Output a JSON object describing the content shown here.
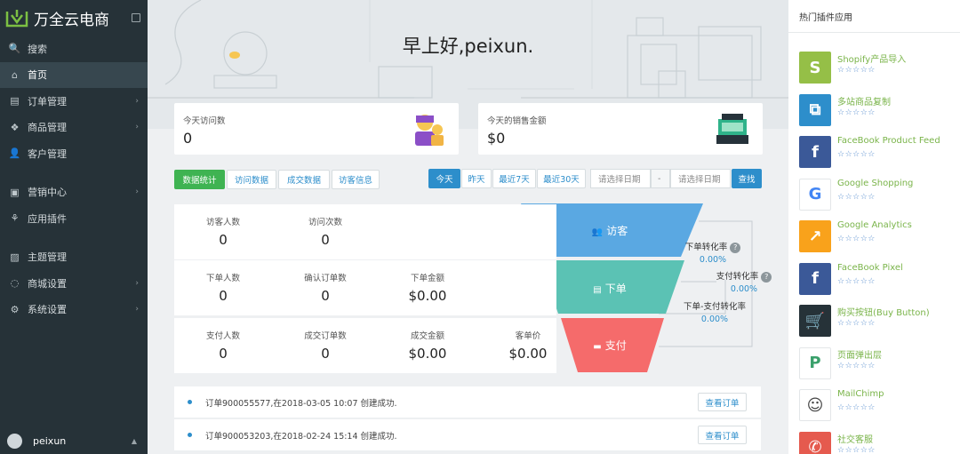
{
  "brand": {
    "name": "万全云电商"
  },
  "nav": [
    {
      "label": "搜索",
      "icon": "search-icon",
      "glyph": "🔍"
    },
    {
      "label": "首页",
      "icon": "home-icon",
      "glyph": "⌂",
      "active": true
    },
    {
      "label": "订单管理",
      "icon": "order-icon",
      "glyph": "▤",
      "arrow": true
    },
    {
      "label": "商品管理",
      "icon": "goods-icon",
      "glyph": "❖",
      "arrow": true
    },
    {
      "label": "客户管理",
      "icon": "customer-icon",
      "glyph": "👤"
    },
    {
      "label": "营销中心",
      "icon": "marketing-icon",
      "glyph": "▣",
      "arrow": true,
      "gap": true
    },
    {
      "label": "应用插件",
      "icon": "plugin-icon",
      "glyph": "⚘"
    },
    {
      "label": "主题管理",
      "icon": "theme-icon",
      "glyph": "▨",
      "gap": true
    },
    {
      "label": "商城设置",
      "icon": "mall-settings-icon",
      "glyph": "◌",
      "arrow": true
    },
    {
      "label": "系统设置",
      "icon": "system-settings-icon",
      "glyph": "⚙",
      "arrow": true
    }
  ],
  "user": {
    "name": "peixun"
  },
  "greeting": "早上好,peixun.",
  "stats": {
    "visits": {
      "label": "今天访问数",
      "value": "0"
    },
    "sales": {
      "label": "今天的销售金额",
      "value": "$0"
    }
  },
  "tabs": [
    "数据统计",
    "访问数据",
    "成交数据",
    "访客信息"
  ],
  "ranges": [
    "今天",
    "昨天",
    "最近7天",
    "最近30天"
  ],
  "date_range": {
    "start_placeholder": "请选择日期",
    "separator": "-",
    "end_placeholder": "请选择日期",
    "search_label": "查找"
  },
  "funnel": {
    "rows": [
      {
        "cells": [
          {
            "label": "访客人数",
            "value": "0"
          },
          {
            "label": "访问次数",
            "value": "0"
          }
        ]
      },
      {
        "cells": [
          {
            "label": "下单人数",
            "value": "0"
          },
          {
            "label": "确认订单数",
            "value": "0"
          },
          {
            "label": "下单金额",
            "value": "$0.00"
          }
        ]
      },
      {
        "cells": [
          {
            "label": "支付人数",
            "value": "0"
          },
          {
            "label": "成交订单数",
            "value": "0"
          },
          {
            "label": "成交金额",
            "value": "$0.00"
          },
          {
            "label": "客单价",
            "value": "$0.00"
          }
        ]
      }
    ],
    "stages": [
      "访客",
      "下单",
      "支付"
    ],
    "colors": [
      "#5aa8e2",
      "#5bc2b4",
      "#f56b6b"
    ],
    "rates": [
      {
        "label": "下单转化率",
        "value": "0.00%"
      },
      {
        "label": "支付转化率",
        "value": "0.00%"
      },
      {
        "label": "下单-支付转化率",
        "value": "0.00%"
      }
    ]
  },
  "orders": [
    {
      "text": "订单900055577,在2018-03-05 10:07 创建成功.",
      "action": "查看订单"
    },
    {
      "text": "订单900053203,在2018-02-24 15:14 创建成功.",
      "action": "查看订单"
    }
  ],
  "plugins_title": "热门插件应用",
  "plugins": [
    {
      "name": "Shopify产品导入",
      "stars": "☆☆☆☆☆",
      "color": "#95bf47",
      "glyph": "S"
    },
    {
      "name": "多站商品复制",
      "stars": "☆☆☆☆☆",
      "color": "#2d8ecb",
      "glyph": "⧉"
    },
    {
      "name": "FaceBook Product Feed",
      "stars": "☆☆☆☆☆",
      "color": "#3b5998",
      "glyph": "f"
    },
    {
      "name": "Google Shopping",
      "stars": "☆☆☆☆☆",
      "color": "#ffffff",
      "glyph": "G"
    },
    {
      "name": "Google Analytics",
      "stars": "☆☆☆☆☆",
      "color": "#f9a21b",
      "glyph": "↗"
    },
    {
      "name": "FaceBook Pixel",
      "stars": "☆☆☆☆☆",
      "color": "#3b5998",
      "glyph": "f"
    },
    {
      "name": "购买按钮(Buy Button)",
      "stars": "☆☆☆☆☆",
      "color": "#263238",
      "glyph": "🛒"
    },
    {
      "name": "页面弹出层",
      "stars": "☆☆☆☆☆",
      "color": "#ffffff",
      "glyph": "P"
    },
    {
      "name": "MailChimp",
      "stars": "☆☆☆☆☆",
      "color": "#ffffff",
      "glyph": "☺"
    },
    {
      "name": "社交客服",
      "stars": "☆☆☆☆☆",
      "color": "#e55a4e",
      "glyph": "✆"
    }
  ]
}
